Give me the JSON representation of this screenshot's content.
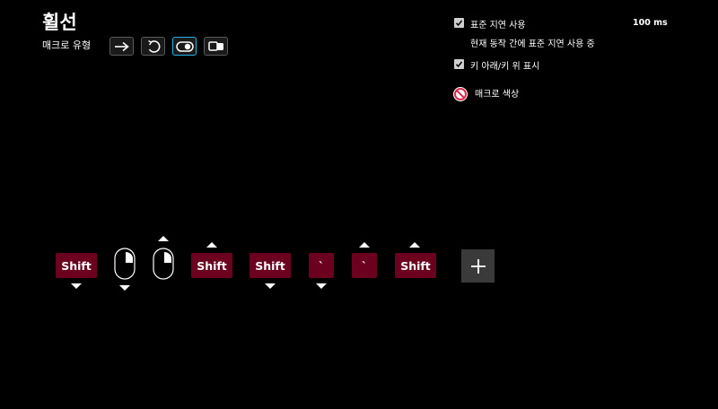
{
  "title": "휠선",
  "macro_type": {
    "label": "매크로 유형",
    "buttons": [
      {
        "icon": "arrow-right-icon",
        "active": false
      },
      {
        "icon": "repeat-icon",
        "active": false
      },
      {
        "icon": "toggle-icon",
        "active": true
      },
      {
        "icon": "sequence-icon",
        "active": false
      }
    ]
  },
  "options": {
    "standard_delay": {
      "label": "표준 지연 사용",
      "checked": true,
      "value": "100 ms"
    },
    "delay_note": "현재 동작 간에 표준 지연 사용 중",
    "show_key_updown": {
      "label": "키 아래/키 위 표시",
      "checked": true
    },
    "macro_color": {
      "label": "매크로 색상",
      "icon": "no-color-icon"
    }
  },
  "sequence": [
    {
      "kind": "key",
      "label": "Shift",
      "direction": "down"
    },
    {
      "kind": "mouse",
      "button": "right",
      "direction": "down"
    },
    {
      "kind": "mouse",
      "button": "right",
      "direction": "up"
    },
    {
      "kind": "key",
      "label": "Shift",
      "direction": "up"
    },
    {
      "kind": "key",
      "label": "Shift",
      "direction": "down"
    },
    {
      "kind": "key",
      "label": "`",
      "direction": "down"
    },
    {
      "kind": "key",
      "label": "`",
      "direction": "up"
    },
    {
      "kind": "key",
      "label": "Shift",
      "direction": "up"
    }
  ],
  "colors": {
    "key_bg": "#6b001f",
    "accent": "#22b3e8",
    "add_bg": "#3a3a3a"
  },
  "add_button_icon": "plus-icon"
}
